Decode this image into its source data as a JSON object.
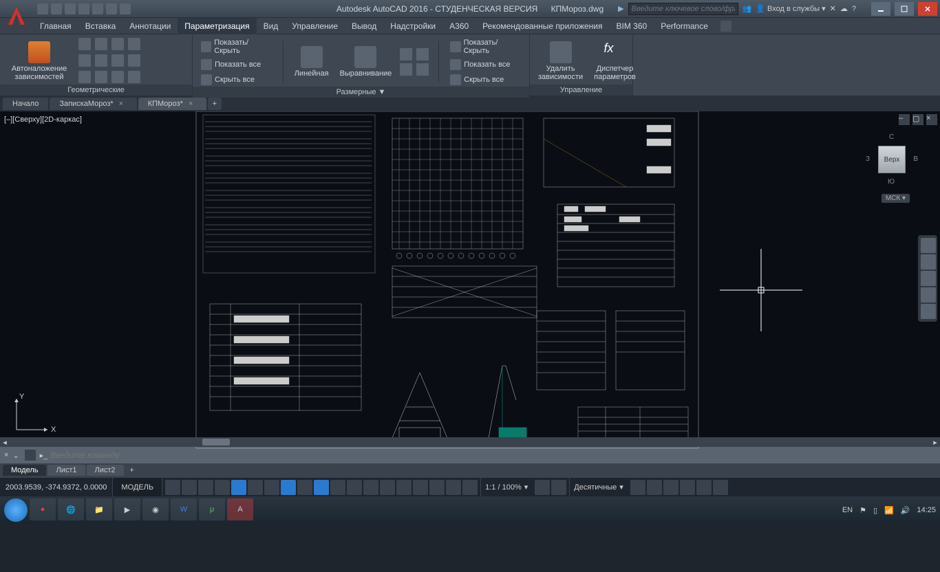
{
  "title_app": "Autodesk AutoCAD 2016 - СТУДЕНЧЕСКАЯ ВЕРСИЯ",
  "title_file": "КПМороз.dwg",
  "search_placeholder": "Введите ключевое слово/фразу",
  "login_text": "Вход в службы",
  "menu": {
    "items": [
      "Главная",
      "Вставка",
      "Аннотации",
      "Параметризация",
      "Вид",
      "Управление",
      "Вывод",
      "Надстройки",
      "A360",
      "Рекомендованные приложения",
      "BIM 360",
      "Performance"
    ],
    "active": 3
  },
  "ribbon": {
    "panel1": {
      "title": "Геометрические",
      "btn": "Автоналожение зависимостей"
    },
    "panel2": {
      "title": "Размерные ▼",
      "items": [
        "Показать/Скрыть",
        "Показать все",
        "Скрыть все"
      ],
      "btn1": "Линейная",
      "btn2": "Выравнивание",
      "items2": [
        "Показать/Скрыть",
        "Показать все",
        "Скрыть все"
      ]
    },
    "panel3": {
      "title": "Управление",
      "btn1": "Удалить зависимости",
      "btn2": "Диспетчер параметров"
    }
  },
  "filetabs": {
    "items": [
      "Начало",
      "ЗапискаМороз*",
      "КПМороз*"
    ],
    "active": 2
  },
  "viewport_label": "[–][Сверху][2D-каркас]",
  "viewcube": {
    "face": "Верх",
    "n": "С",
    "s": "Ю",
    "e": "В",
    "w": "З",
    "wcs": "МСК ▾"
  },
  "cmd_placeholder": "Введите команду",
  "layout_tabs": {
    "items": [
      "Модель",
      "Лист1",
      "Лист2"
    ],
    "active": 0
  },
  "status": {
    "coords": "2003.9539, -374.9372, 0.0000",
    "model": "МОДЕЛЬ",
    "scale": "1:1 / 100%",
    "units": "Десятичные"
  },
  "taskbar": {
    "lang": "EN",
    "time": "14:25"
  }
}
